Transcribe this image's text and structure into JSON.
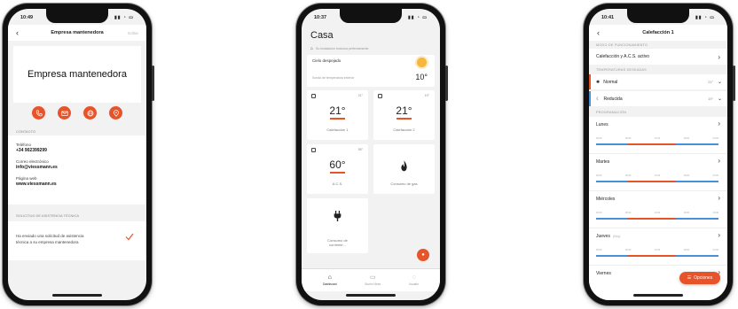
{
  "phone1": {
    "time": "10:49",
    "nav_title": "Empresa mantenedora",
    "nav_edit": "Editar",
    "company_logo_text": "Empresa mantenedora",
    "actions": [
      "phone-icon",
      "mail-icon",
      "globe-icon",
      "location-icon"
    ],
    "contact_header": "Contacto",
    "contact": [
      {
        "label": "Teléfono",
        "value": "+34 902399299"
      },
      {
        "label": "Correo electrónico",
        "value": "info@viessmann.es"
      },
      {
        "label": "Página web",
        "value": "www.viessmann.es"
      }
    ],
    "assistance_header": "Solicitud de asistencia técnica",
    "assistance_message": "Ha enviado una solicitud de asistencia técnica a su empresa mantenedora"
  },
  "phone2": {
    "time": "10:37",
    "title": "Casa",
    "subtitle": "Su instalación funciona perfectamente.",
    "weather": {
      "condition": "Cielo despejado",
      "location": "",
      "outdoor_label": "Sonda de temperatura exterior",
      "outdoor_temp": "10°"
    },
    "tiles": [
      {
        "small": "21°",
        "big": "21°",
        "name": "Calefacción 1"
      },
      {
        "small": "19°",
        "big": "21°",
        "name": "Calefacción 2"
      },
      {
        "small": "55°",
        "big": "60°",
        "name": "A.C.S."
      },
      {
        "small": "",
        "big": "",
        "name": "Consumo de gas"
      },
      {
        "small": "",
        "big": "",
        "name": "Consumo de corriente..."
      }
    ],
    "tabs": [
      {
        "label": "Dashboard",
        "icon": "house-icon"
      },
      {
        "label": "Buzón Viess",
        "icon": "inbox-icon"
      },
      {
        "label": "Usuario",
        "icon": "user-icon"
      }
    ]
  },
  "phone3": {
    "time": "10:41",
    "nav_title": "Calefacción 1",
    "mode_header": "Modo de funcionamiento",
    "mode_value": "Calefacción y A.C.S. activo",
    "temps_header": "Temperaturas deseadas",
    "temps": [
      {
        "label": "Normal",
        "value": "21°",
        "color": "#e8542a"
      },
      {
        "label": "Reducida",
        "value": "19°",
        "color": "#4a90d9"
      }
    ],
    "program_header": "Programación",
    "times": [
      "00:00",
      "06:00",
      "12:00",
      "18:00",
      "24:00"
    ],
    "days": [
      {
        "name": "Lunes",
        "note": ""
      },
      {
        "name": "Martes",
        "note": ""
      },
      {
        "name": "Miércoles",
        "note": ""
      },
      {
        "name": "Jueves",
        "note": "(Hoy)"
      },
      {
        "name": "Viernes",
        "note": ""
      }
    ],
    "options_label": "Opciones"
  },
  "colors": {
    "accent": "#e8542a",
    "blue": "#4a90d9"
  }
}
